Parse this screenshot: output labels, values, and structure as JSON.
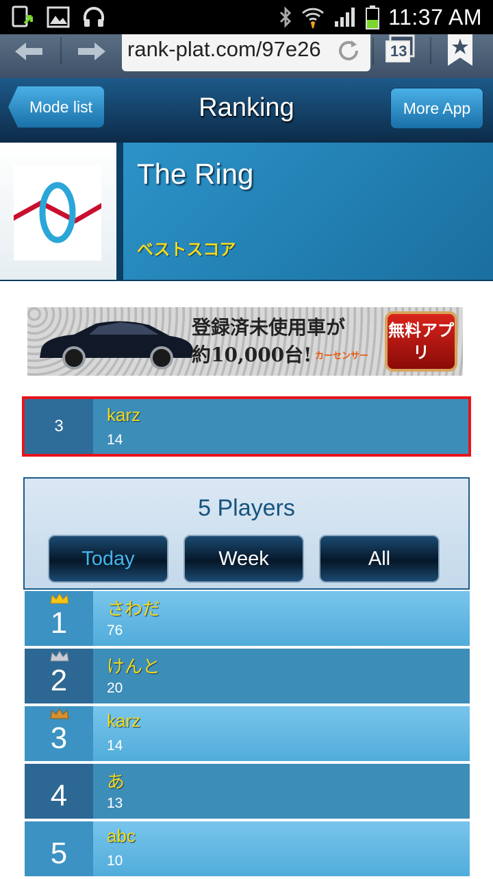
{
  "status_bar": {
    "time": "11:37 AM",
    "icons": [
      "sim-update-icon",
      "image-icon",
      "headphones-icon",
      "bluetooth-icon",
      "wifi-icon",
      "signal-icon",
      "battery-icon"
    ]
  },
  "browser": {
    "url": "rank-plat.com/97e26",
    "tab_count": "13"
  },
  "header": {
    "back_label": "Mode list",
    "title": "Ranking",
    "more_label": "More App"
  },
  "game": {
    "title": "The Ring",
    "mode": "ベストスコア"
  },
  "ad": {
    "line1": "登録済未使用車が",
    "line2": "約10,000台!",
    "brand": "カーセンサー",
    "button": "無料アプリ"
  },
  "my_rank": {
    "rank": "3",
    "name": "karz",
    "score": "14"
  },
  "players": {
    "count_label": "5 Players",
    "periods": [
      {
        "label": "Today",
        "active": true
      },
      {
        "label": "Week",
        "active": false
      },
      {
        "label": "All",
        "active": false
      }
    ]
  },
  "ranking": [
    {
      "rank": "1",
      "name": "さわだ",
      "score": "76",
      "crown": "gold"
    },
    {
      "rank": "2",
      "name": "けんと",
      "score": "20",
      "crown": "silver"
    },
    {
      "rank": "3",
      "name": "karz",
      "score": "14",
      "crown": "bronze"
    },
    {
      "rank": "4",
      "name": "あ",
      "score": "13",
      "crown": ""
    },
    {
      "rank": "5",
      "name": "abc",
      "score": "10",
      "crown": ""
    }
  ],
  "colors": {
    "accent": "#1d7fb3",
    "name_yellow": "#f2da1e",
    "highlight_border": "#e8131c",
    "crown_gold": "#f5c518",
    "crown_silver": "#c8ccd4",
    "crown_bronze": "#d9902e"
  }
}
